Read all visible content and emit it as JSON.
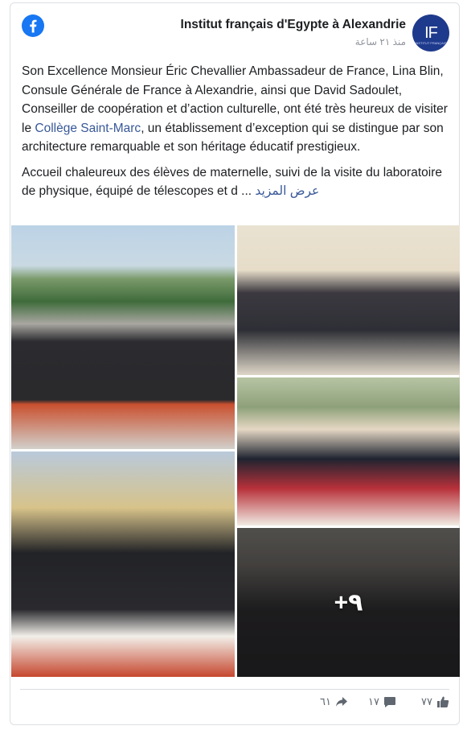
{
  "header": {
    "page_name": "Institut français d'Egypte à Alexandrie",
    "timestamp": "منذ ٢١ ساعة",
    "avatar_text": "IF",
    "avatar_sub": "INSTITUT FRANÇAIS"
  },
  "post": {
    "paragraph1_before_link": "Son Excellence Monsieur Éric Chevallier Ambassadeur de France, Lina Blin, Consule Générale de France à Alexandrie, ainsi que David Sadoulet, Conseiller de coopération et d’action culturelle, ont été très heureux de visiter le ",
    "paragraph1_link": "Collège Saint-Marc",
    "paragraph1_after_link": ", un établissement d’exception qui se distingue par son architecture remarquable et son héritage éducatif prestigieux.",
    "paragraph2": "Accueil chaleureux des élèves de maternelle, suivi de la visite du laboratoire de physique, équipé de télescopes et d ... ",
    "see_more": "عرض المزيد"
  },
  "photos": {
    "more_count": "+٩"
  },
  "footer": {
    "likes": "٧٧",
    "comments": "١٧",
    "shares": "٦١"
  },
  "colors": {
    "facebook_blue": "#1877f2",
    "link": "#385898",
    "avatar_bg": "#1e3a8c"
  }
}
